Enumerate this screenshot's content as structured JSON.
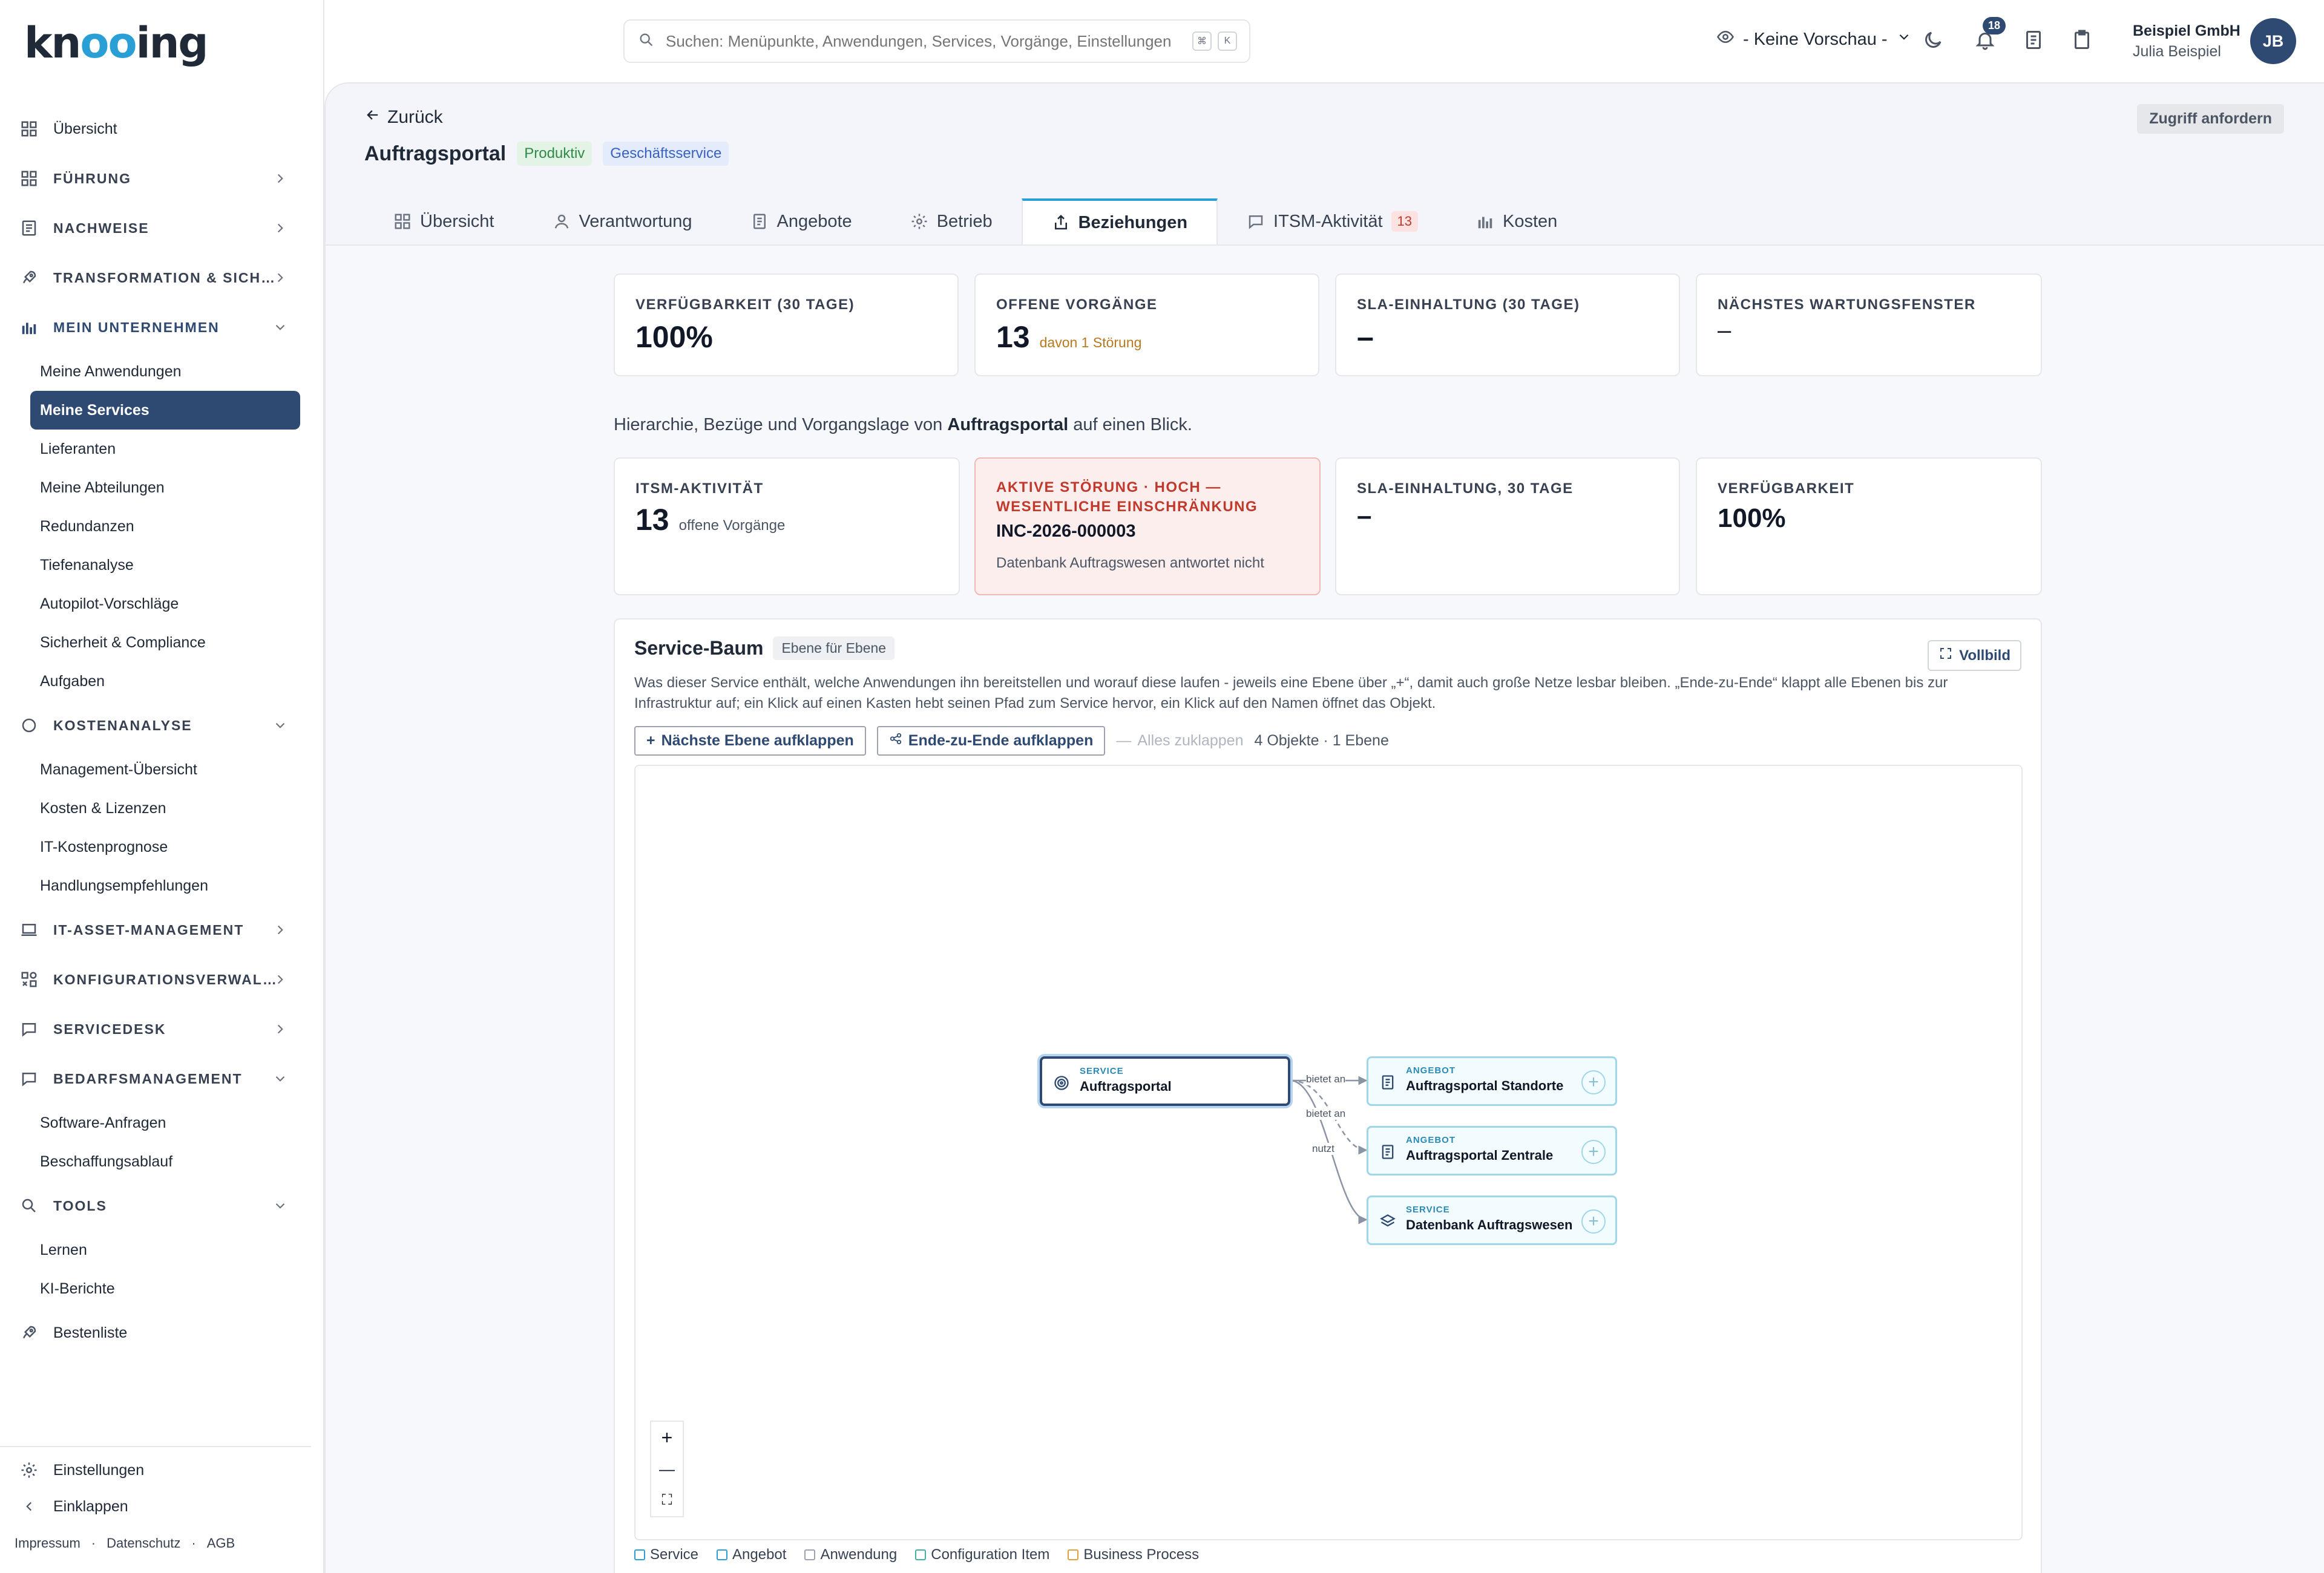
{
  "brand": {
    "logo_text": "knooing",
    "accent": "#2a9fd6",
    "primary": "#2f4a72"
  },
  "sidebar": {
    "items": [
      {
        "label": "Übersicht",
        "icon": "grid-icon",
        "type": "item"
      },
      {
        "label": "FÜHRUNG",
        "icon": "grid-icon",
        "type": "section",
        "chevron": "right"
      },
      {
        "label": "NACHWEISE",
        "icon": "document-icon",
        "type": "section",
        "chevron": "right"
      },
      {
        "label": "TRANSFORMATION & SICH…",
        "icon": "rocket-icon",
        "type": "section",
        "chevron": "right"
      },
      {
        "label": "MEIN UNTERNEHMEN",
        "icon": "bar-chart-icon",
        "type": "section",
        "chevron": "down"
      }
    ],
    "mein_unternehmen": [
      "Meine Anwendungen",
      "Meine Services",
      "Lieferanten",
      "Meine Abteilungen",
      "Redundanzen",
      "Tiefenanalyse",
      "Autopilot-Vorschläge",
      "Sicherheit & Compliance",
      "Aufgaben"
    ],
    "kostenanalyse_label": "KOSTENANALYSE",
    "kostenanalyse": [
      "Management-Übersicht",
      "Kosten & Lizenzen",
      "IT-Kostenprognose",
      "Handlungsempfehlungen"
    ],
    "it_asset": "IT-ASSET-MANAGEMENT",
    "konfig": "KONFIGURATIONSVERWAL…",
    "servicedesk": "SERVICEDESK",
    "bedarf_label": "BEDARFSMANAGEMENT",
    "bedarf": [
      "Software-Anfragen",
      "Beschaffungsablauf"
    ],
    "tools_label": "TOOLS",
    "tools": [
      "Lernen",
      "KI-Berichte"
    ],
    "bestenliste": "Bestenliste",
    "settings": "Einstellungen",
    "collapse": "Einklappen",
    "footer": [
      "Impressum",
      "·",
      "Datenschutz",
      "·",
      "AGB"
    ]
  },
  "topbar": {
    "search_placeholder": "Suchen: Menüpunkte, Anwendungen, Services, Vorgänge, Einstellungen",
    "kbd": [
      "⌘",
      "K"
    ],
    "preview": "- Keine Vorschau -",
    "notifications": "18",
    "org": "Beispiel GmbH",
    "user": "Julia Beispiel",
    "initials": "JB"
  },
  "page": {
    "back": "Zurück",
    "title": "Auftragsportal",
    "tags": [
      "Produktiv",
      "Geschäftsservice"
    ],
    "access": "Zugriff anfordern",
    "tabs": [
      {
        "label": "Übersicht",
        "icon": "grid-icon"
      },
      {
        "label": "Verantwortung",
        "icon": "user-icon"
      },
      {
        "label": "Angebote",
        "icon": "document-icon"
      },
      {
        "label": "Betrieb",
        "icon": "gear-icon"
      },
      {
        "label": "Beziehungen",
        "icon": "share-icon"
      },
      {
        "label": "ITSM-Aktivität",
        "icon": "chat-icon",
        "count": "13"
      },
      {
        "label": "Kosten",
        "icon": "bar-chart-icon"
      }
    ]
  },
  "kpis": [
    {
      "key": "VERFÜGBARKEIT (30 TAGE)",
      "value": "100%"
    },
    {
      "key": "OFFENE VORGÄNGE",
      "value": "13",
      "note": "davon 1 Störung"
    },
    {
      "key": "SLA-EINHALTUNG (30 TAGE)",
      "value": "–"
    },
    {
      "key": "NÄCHSTES WARTUNGSFENSTER",
      "value": "–"
    }
  ],
  "intro": {
    "pre": "Hierarchie, Bezüge und Vorgangslage von",
    "name": "Auftragsportal",
    "post": "auf einen Blick."
  },
  "summary": {
    "itsm_key": "ITSM-AKTIVITÄT",
    "itsm_value": "13",
    "itsm_note": "offene Vorgänge",
    "alert_key": "AKTIVE STÖRUNG · HOCH — WESENTLICHE EINSCHRÄNKUNG",
    "alert_id": "INC-2026-000003",
    "alert_desc": "Datenbank Auftragswesen antwortet nicht",
    "sla_key": "SLA-EINHALTUNG, 30 TAGE",
    "sla_value": "–",
    "avail_key": "VERFÜGBARKEIT",
    "avail_value": "100%"
  },
  "tree": {
    "title": "Service-Baum",
    "mode": "Ebene für Ebene",
    "fullscreen": "Vollbild",
    "desc": "Was dieser Service enthält, welche Anwendungen ihn bereitstellen und worauf diese laufen - jeweils eine Ebene über „+“, damit auch große Netze lesbar bleiben. „Ende-zu-Ende“ klappt alle Ebenen bis zur Infrastruktur auf; ein Klick auf einen Kasten hebt seinen Pfad zum Service hervor, ein Klick auf den Namen öffnet das Objekt.",
    "btn_next": "Nächste Ebene aufklappen",
    "btn_e2e": "Ende-zu-Ende aufklappen",
    "btn_collapse": "Alles zuklappen",
    "meta": "4 Objekte · 1 Ebene",
    "nodes": [
      {
        "kind": "SERVICE",
        "name": "Auftragsportal"
      },
      {
        "kind": "ANGEBOT",
        "name": "Auftragsportal Standorte"
      },
      {
        "kind": "ANGEBOT",
        "name": "Auftragsportal Zentrale"
      },
      {
        "kind": "SERVICE",
        "name": "Datenbank Auftragswesen"
      }
    ],
    "edges": [
      "bietet an",
      "bietet an",
      "nutzt"
    ],
    "zoom": [
      "+",
      "—",
      "⛶"
    ],
    "legend": [
      {
        "label": "Service",
        "color": "#2a9fd6"
      },
      {
        "label": "Angebot",
        "color": "#2a9fd6"
      },
      {
        "label": "Anwendung",
        "color": "#9ca3af"
      },
      {
        "label": "Configuration Item",
        "color": "#3fb4a0"
      },
      {
        "label": "Business Process",
        "color": "#e0a040"
      }
    ]
  }
}
